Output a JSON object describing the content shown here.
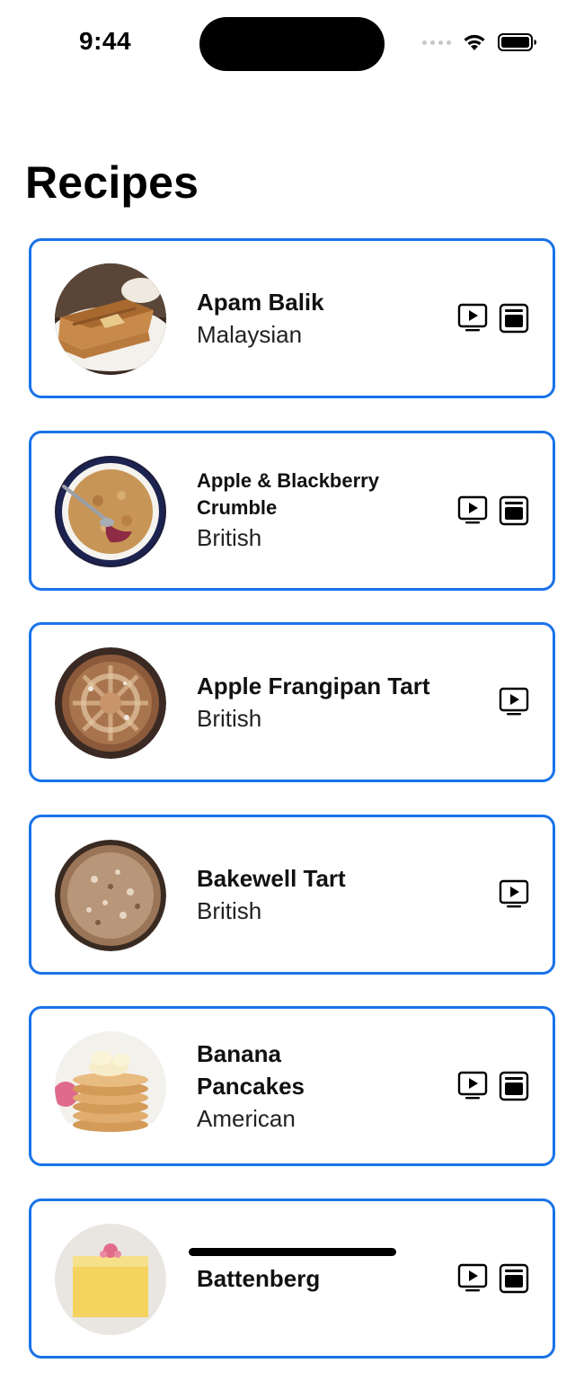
{
  "status_bar": {
    "time": "9:44"
  },
  "page": {
    "title": "Recipes"
  },
  "recipes": [
    {
      "name": "Apam Balik",
      "area": "Malaysian",
      "has_video": true,
      "has_source": true,
      "image": "apam-balik-image"
    },
    {
      "name": "Apple & Blackberry Crumble",
      "area": "British",
      "has_video": true,
      "has_source": true,
      "image": "crumble-image"
    },
    {
      "name": "Apple Frangipan Tart",
      "area": "British",
      "has_video": true,
      "has_source": false,
      "image": "frangipan-tart-image"
    },
    {
      "name": "Bakewell Tart",
      "area": "British",
      "has_video": true,
      "has_source": false,
      "image": "bakewell-tart-image"
    },
    {
      "name": "Banana Pancakes",
      "area": "American",
      "has_video": true,
      "has_source": true,
      "image": "banana-pancakes-image"
    },
    {
      "name": "Battenberg",
      "area": "",
      "has_video": true,
      "has_source": true,
      "image": "battenberg-image"
    }
  ],
  "icons": {
    "video": "play-video-icon",
    "source": "source-card-icon"
  },
  "colors": {
    "card_border": "#1a73e8",
    "background": "#ffffff"
  }
}
